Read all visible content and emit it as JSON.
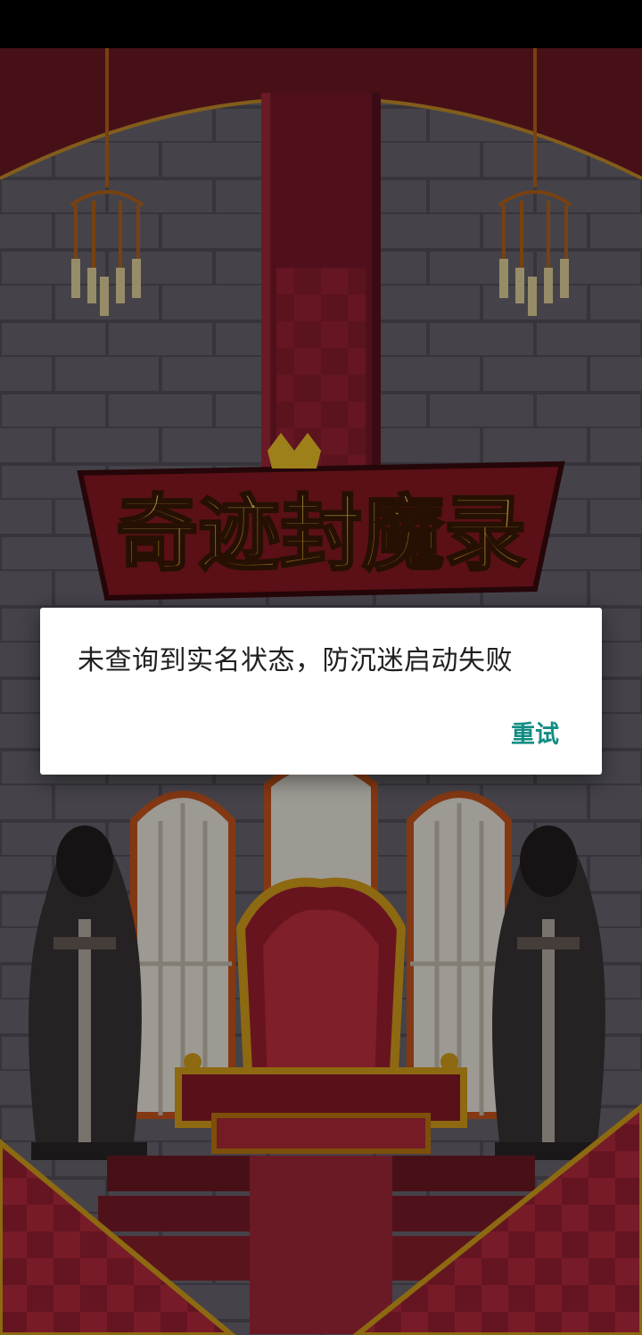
{
  "game": {
    "logo_text": "奇迹封魔录"
  },
  "dialog": {
    "message": "未查询到实名状态，防沉迷启动失败",
    "retry_label": "重试"
  },
  "colors": {
    "accent": "#128d84",
    "banner": "#7a1a2a",
    "carpet": "#9b1e2c",
    "gold": "#d9a21c",
    "wall": "#5a5660"
  }
}
